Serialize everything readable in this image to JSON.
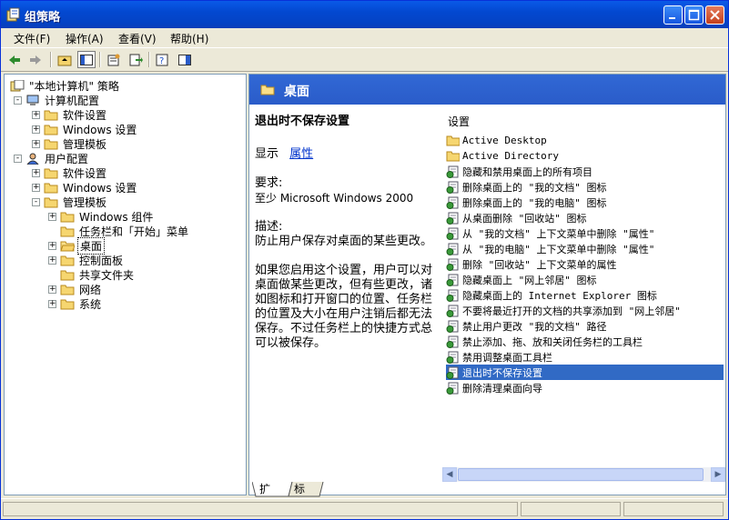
{
  "window": {
    "title": "组策略"
  },
  "menu": [
    "文件(F)",
    "操作(A)",
    "查看(V)",
    "帮助(H)"
  ],
  "tree": [
    {
      "label": "\"本地计算机\" 策略",
      "level": 0,
      "expander": "",
      "icon": "policy-icon"
    },
    {
      "label": "计算机配置",
      "level": 1,
      "expander": "-",
      "icon": "computer-icon"
    },
    {
      "label": "软件设置",
      "level": 2,
      "expander": "+",
      "icon": "folder-icon"
    },
    {
      "label": "Windows 设置",
      "level": 2,
      "expander": "+",
      "icon": "folder-icon"
    },
    {
      "label": "管理模板",
      "level": 2,
      "expander": "+",
      "icon": "folder-icon"
    },
    {
      "label": "用户配置",
      "level": 1,
      "expander": "-",
      "icon": "user-icon"
    },
    {
      "label": "软件设置",
      "level": 2,
      "expander": "+",
      "icon": "folder-icon"
    },
    {
      "label": "Windows 设置",
      "level": 2,
      "expander": "+",
      "icon": "folder-icon"
    },
    {
      "label": "管理模板",
      "level": 2,
      "expander": "-",
      "icon": "folder-icon"
    },
    {
      "label": "Windows 组件",
      "level": 3,
      "expander": "+",
      "icon": "folder-icon"
    },
    {
      "label": "任务栏和「开始」菜单",
      "level": 3,
      "expander": "",
      "icon": "folder-icon"
    },
    {
      "label": "桌面",
      "level": 3,
      "expander": "+",
      "icon": "folder-open-icon",
      "selected": true
    },
    {
      "label": "控制面板",
      "level": 3,
      "expander": "+",
      "icon": "folder-icon"
    },
    {
      "label": "共享文件夹",
      "level": 3,
      "expander": "",
      "icon": "folder-icon"
    },
    {
      "label": "网络",
      "level": 3,
      "expander": "+",
      "icon": "folder-icon"
    },
    {
      "label": "系统",
      "level": 3,
      "expander": "+",
      "icon": "folder-icon"
    }
  ],
  "right": {
    "header": "桌面",
    "setting_title": "退出时不保存设置",
    "display_prefix": "显示",
    "properties_link": "属性",
    "requirement_label": "要求:",
    "requirement_value": "至少 Microsoft Windows 2000",
    "description_label": "描述:",
    "description_1": "防止用户保存对桌面的某些更改。",
    "description_2": "如果您启用这个设置，用户可以对桌面做某些更改，但有些更改，诸如图标和打开窗口的位置、任务栏的位置及大小在用户注销后都无法保存。不过任务栏上的快捷方式总可以被保存。",
    "list_header": "设置",
    "items": [
      {
        "label": "Active Desktop",
        "icon": "folder-icon"
      },
      {
        "label": "Active Directory",
        "icon": "folder-icon"
      },
      {
        "label": "隐藏和禁用桌面上的所有项目",
        "icon": "setting-icon"
      },
      {
        "label": "删除桌面上的 \"我的文档\" 图标",
        "icon": "setting-icon"
      },
      {
        "label": "删除桌面上的 \"我的电脑\" 图标",
        "icon": "setting-icon"
      },
      {
        "label": "从桌面删除 \"回收站\" 图标",
        "icon": "setting-icon"
      },
      {
        "label": "从 \"我的文档\" 上下文菜单中删除 \"属性\"",
        "icon": "setting-icon"
      },
      {
        "label": "从 \"我的电脑\" 上下文菜单中删除 \"属性\"",
        "icon": "setting-icon"
      },
      {
        "label": "删除 \"回收站\" 上下文菜单的属性",
        "icon": "setting-icon"
      },
      {
        "label": "隐藏桌面上 \"网上邻居\" 图标",
        "icon": "setting-icon"
      },
      {
        "label": "隐藏桌面上的 Internet Explorer 图标",
        "icon": "setting-icon"
      },
      {
        "label": "不要将最近打开的文档的共享添加到 \"网上邻居\"",
        "icon": "setting-icon"
      },
      {
        "label": "禁止用户更改 \"我的文档\" 路径",
        "icon": "setting-icon"
      },
      {
        "label": "禁止添加、拖、放和关闭任务栏的工具栏",
        "icon": "setting-icon"
      },
      {
        "label": "禁用调整桌面工具栏",
        "icon": "setting-icon"
      },
      {
        "label": "退出时不保存设置",
        "icon": "setting-icon",
        "selected": true
      },
      {
        "label": "删除清理桌面向导",
        "icon": "setting-icon"
      }
    ]
  },
  "tabs": [
    "扩展",
    "标准"
  ],
  "colors": {
    "titlebar": "#0348d0",
    "selection": "#316ac5",
    "header": "#2a5cc9"
  }
}
